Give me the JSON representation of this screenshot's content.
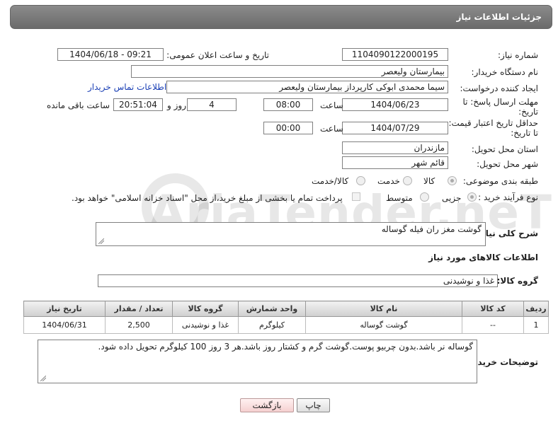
{
  "header": {
    "title": "جزئیات اطلاعات نیاز"
  },
  "form": {
    "need_number_label": "شماره نیاز:",
    "need_number": "1104090122000195",
    "announce_label": "تاریخ و ساعت اعلان عمومی:",
    "announce_value": "1404/06/18 - 09:21",
    "buyer_org_label": "نام دستگاه خریدار:",
    "buyer_org": "بیمارستان ولیعصر",
    "requester_label": "ایجاد کننده درخواست:",
    "requester": "سیما محمدی ابوکی کارپرداز بیمارستان ولیعصر",
    "buyer_contact_link": "اطلاعات تماس خریدار",
    "deadline_label_1": "مهلت ارسال پاسخ: تا",
    "deadline_label_2": "تاریخ:",
    "deadline_date": "1404/06/23",
    "time_label": "ساعت",
    "deadline_time": "08:00",
    "days_value": "4",
    "days_label": "روز و",
    "remaining_time": "20:51:04",
    "remaining_label": "ساعت باقی مانده",
    "price_validity_label_1": "حداقل تاریخ اعتبار قیمت:",
    "price_validity_label_2": "تا تاریخ:",
    "price_validity_date": "1404/07/29",
    "price_validity_time": "00:00",
    "province_label": "استان محل تحویل:",
    "province": "مازندران",
    "city_label": "شهر محل تحویل:",
    "city": "قائم شهر",
    "category_label": "طبقه بندی موضوعی:",
    "category_options": [
      "کالا",
      "خدمت",
      "کالا/خدمت"
    ],
    "process_label": "نوع فرآیند خرید :",
    "process_options": [
      "جزیی",
      "متوسط"
    ],
    "payment_note": "پرداخت تمام یا بخشی از مبلغ خرید،از محل \"اسناد خزانه اسلامی\" خواهد بود.",
    "description_label": "شرح کلی نیاز:",
    "description": "گوشت مغز ران فیله گوساله",
    "goods_info_title": "اطلاعات کالاهای مورد نیاز",
    "goods_group_label": "گروه کالا:",
    "goods_group": "غذا و نوشیدنی",
    "buyer_notes_label": "توضیحات خریدار:",
    "buyer_notes": "گوساله نر باشد.بدون چربیو پوست.گوشت گرم و کشتار روز باشد.هر 3 روز 100 کیلوگرم تحویل داده شود."
  },
  "table": {
    "headers": [
      "ردیف",
      "کد کالا",
      "نام کالا",
      "واحد شمارش",
      "گروه کالا",
      "تعداد / مقدار",
      "تاریخ نیاز"
    ],
    "rows": [
      [
        "1",
        "--",
        "گوشت گوساله",
        "کیلوگرم",
        "غذا و نوشیدنی",
        "2,500",
        "1404/06/31"
      ]
    ]
  },
  "buttons": {
    "print": "چاپ",
    "back": "بازگشت"
  },
  "watermark": {
    "text": "AriaTender.neT"
  },
  "colors": {
    "title_bar": "#7a7a7a",
    "link": "#1a3fb5",
    "back_button": "#f5d0d0"
  }
}
